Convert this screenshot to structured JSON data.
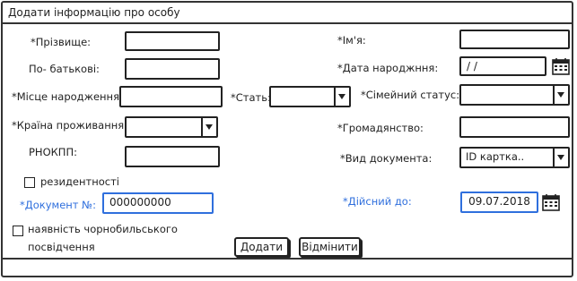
{
  "window": {
    "title": "Додати інформацію про особу"
  },
  "form": {
    "surname_label": "*Прізвище:",
    "name_label": "*Ім'я:",
    "patronymic_label": "По- батькові:",
    "birthdate_label": "*Дата народжння:",
    "birthdate_value": "/ /",
    "birthplace_label": "*Місце народження:",
    "sex_label": "*Стать:",
    "marital_label": "*Сімейний статус:",
    "country_label": "*Країна проживання:",
    "citizenship_label": "*Громадянство:",
    "rnokpp_label": "РНОКПП:",
    "doctype_label": "*Вид документа:",
    "doctype_value": "ID картка..",
    "residency_label": "резидентності",
    "docnum_label": "*Документ №:",
    "docnum_value": "000000000",
    "valid_label": "*Дійсний до:",
    "valid_value": "09.07.2018",
    "chornobyl_label_line1": "наявність чорнобильського",
    "chornobyl_label_line2": "посвідчення"
  },
  "buttons": {
    "add": "Додати",
    "cancel": "Відмінити"
  },
  "icons": [
    "calendar-icon",
    "chevron-down-icon"
  ],
  "colors": {
    "accent": "#2f6fdd",
    "border": "#222222"
  }
}
